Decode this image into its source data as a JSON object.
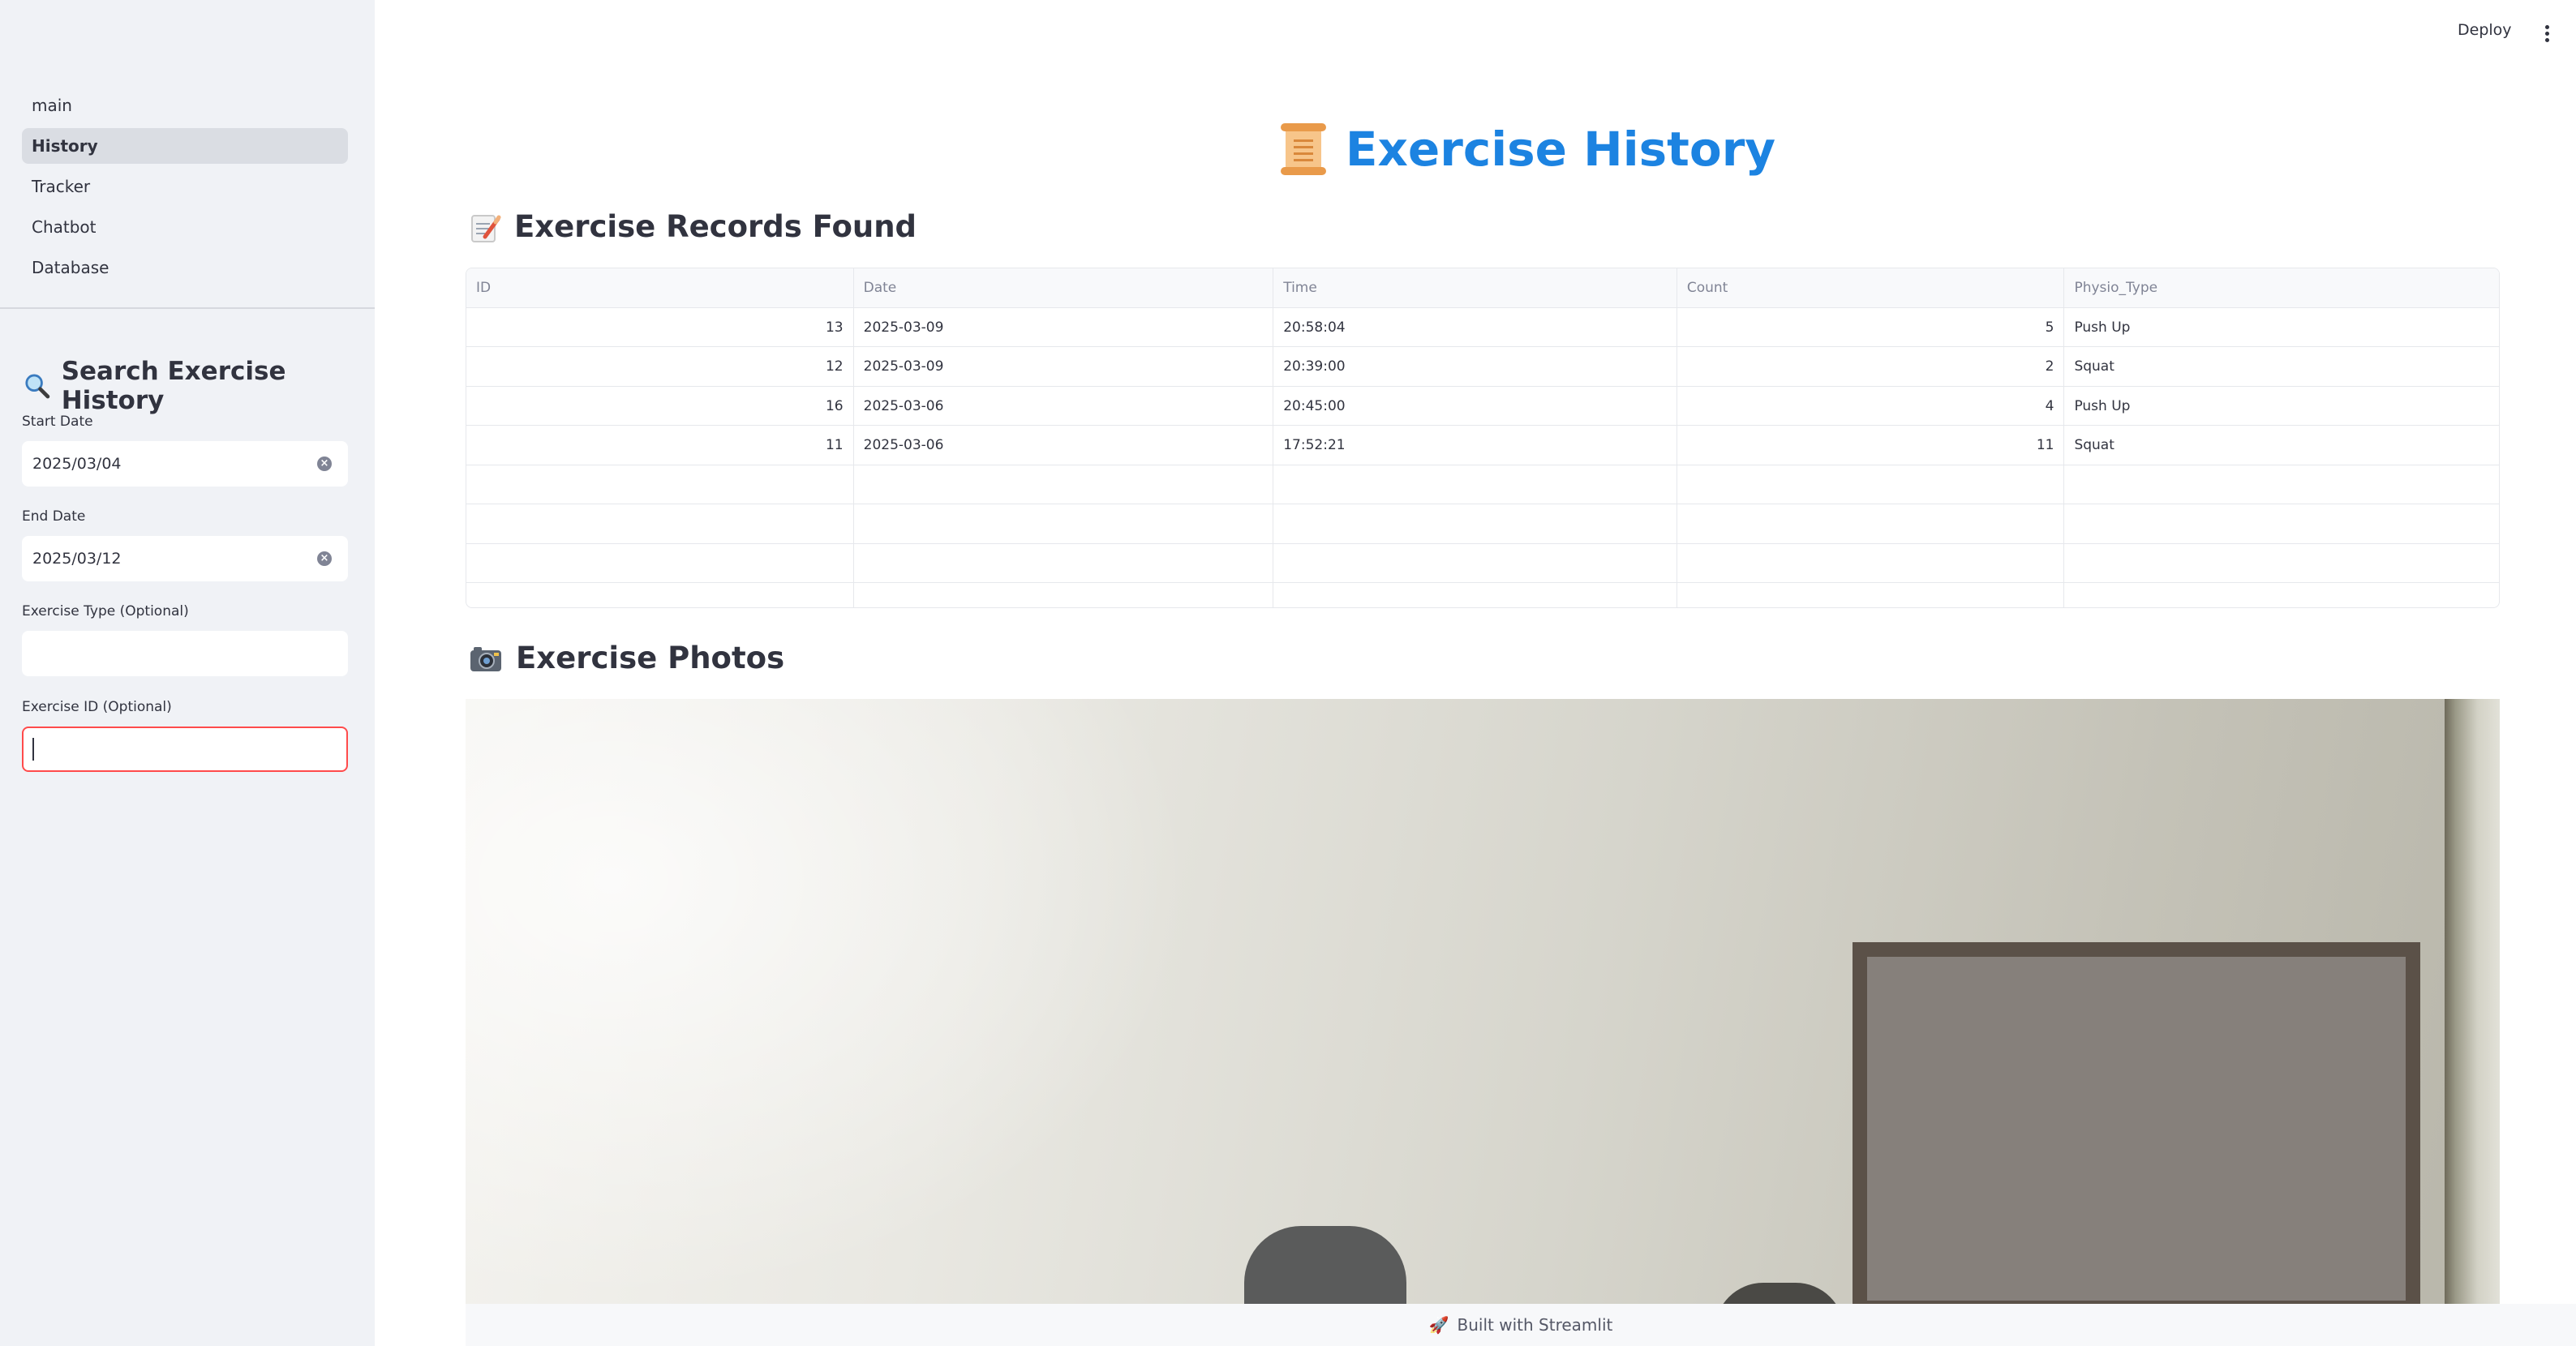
{
  "sidebar": {
    "nav": [
      {
        "label": "main",
        "active": false
      },
      {
        "label": "History",
        "active": true
      },
      {
        "label": "Tracker",
        "active": false
      },
      {
        "label": "Chatbot",
        "active": false
      },
      {
        "label": "Database",
        "active": false
      }
    ],
    "search_heading": "Search Exercise History",
    "start_date": {
      "label": "Start Date",
      "value": "2025/03/04"
    },
    "end_date": {
      "label": "End Date",
      "value": "2025/03/12"
    },
    "exercise_type": {
      "label": "Exercise Type (Optional)",
      "value": ""
    },
    "exercise_id": {
      "label": "Exercise ID (Optional)",
      "value": ""
    }
  },
  "header": {
    "deploy_label": "Deploy"
  },
  "main": {
    "title": "Exercise History",
    "records_heading": "Exercise Records Found",
    "photos_heading": "Exercise Photos",
    "table": {
      "columns": [
        "ID",
        "Date",
        "Time",
        "Count",
        "Physio_Type"
      ],
      "rows": [
        [
          "13",
          "2025-03-09",
          "20:58:04",
          "5",
          "Push Up"
        ],
        [
          "12",
          "2025-03-09",
          "20:39:00",
          "2",
          "Squat"
        ],
        [
          "16",
          "2025-03-06",
          "20:45:00",
          "4",
          "Push Up"
        ],
        [
          "11",
          "2025-03-06",
          "17:52:21",
          "11",
          "Squat"
        ]
      ]
    }
  },
  "footer": {
    "text": "Built with Streamlit"
  },
  "colors": {
    "accent": "#ff4b4b",
    "title": "#1c83e1",
    "sidebar_bg": "#f0f2f6"
  }
}
